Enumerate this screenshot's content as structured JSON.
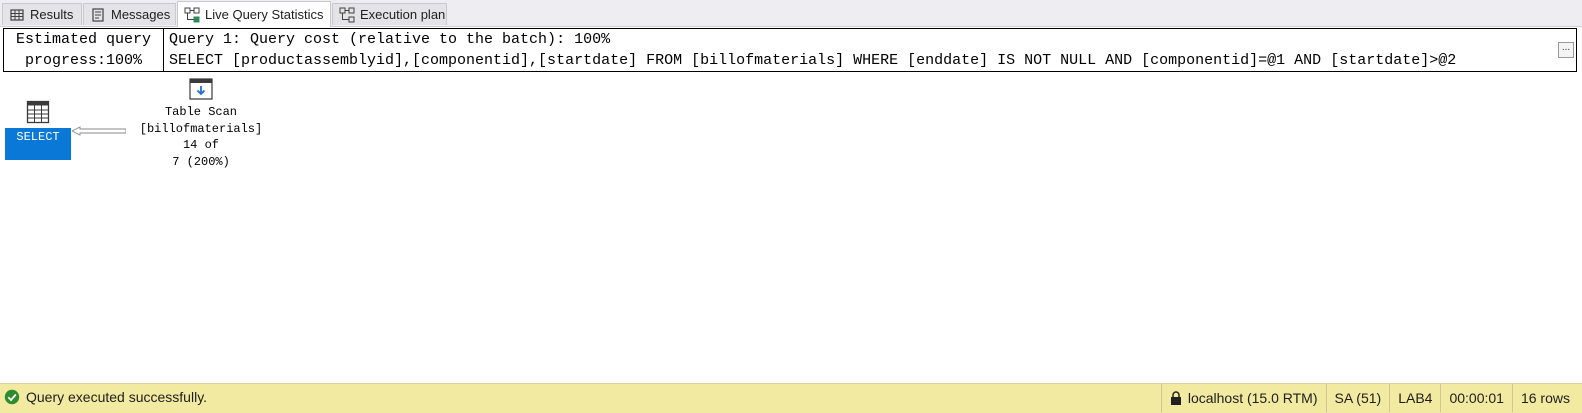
{
  "tabs": [
    {
      "label": "Results",
      "icon": "grid-icon",
      "active": false
    },
    {
      "label": "Messages",
      "icon": "messages-icon",
      "active": false
    },
    {
      "label": "Live Query Statistics",
      "icon": "live-stats-icon",
      "active": true
    },
    {
      "label": "Execution plan",
      "icon": "execution-plan-icon",
      "active": false
    }
  ],
  "plan": {
    "progress_line1": "Estimated query",
    "progress_line2": "progress:100%",
    "query_cost": "Query 1: Query cost (relative to the batch): 100%",
    "query_sql": "SELECT [productassemblyid],[componentid],[startdate] FROM [billofmaterials] WHERE [enddate] IS NOT NULL AND [componentid]=@1 AND [startdate]>@2",
    "ellipsis": "...",
    "select_node": {
      "label": "SELECT",
      "icon": "select-result-icon",
      "highlight_color": "#0A78D7"
    },
    "scan_node": {
      "icon": "table-scan-icon",
      "title": "Table Scan",
      "object": "[billofmaterials]",
      "rows_line1": "14 of",
      "rows_line2": "7 (200%)"
    }
  },
  "status": {
    "message": "Query executed successfully.",
    "icon": "check-circle-icon",
    "server": "localhost (15.0 RTM)",
    "user": "SA (51)",
    "database": "LAB4",
    "elapsed": "00:00:01",
    "rows": "16 rows",
    "bar_color": "#F2EAA0"
  }
}
